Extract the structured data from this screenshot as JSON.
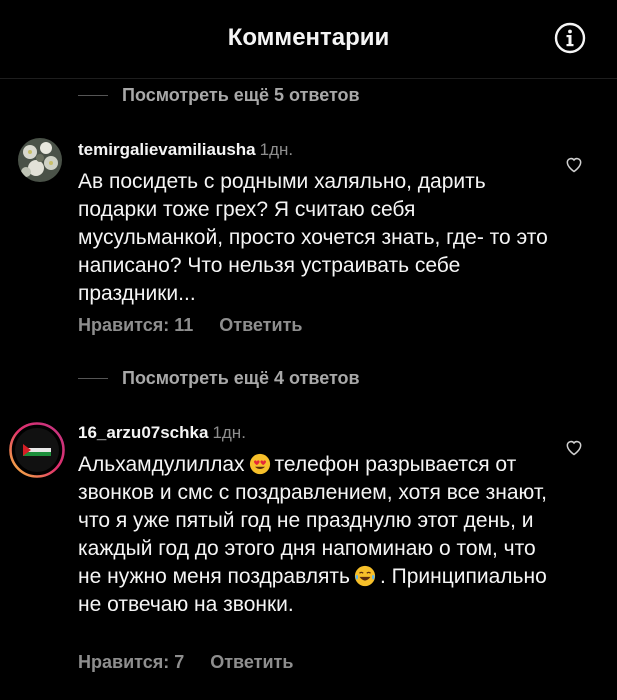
{
  "header": {
    "title": "Комментарии",
    "info_icon": "info-circle-icon"
  },
  "more_replies_1": "Посмотреть ещё 5 ответов",
  "comments": [
    {
      "username": "temirgalievamiliausha",
      "time": "1дн.",
      "text": "Ав посидеть с родными халяльно, дарить подарки  тоже грех? Я считаю себя мусульманкой, просто хочется знать, где- то это написано? Что нельзя устраивать себе праздники...",
      "likes": "Нравится: 11",
      "reply": "Ответить"
    },
    {
      "username": "16_arzu07schka",
      "time": "1дн.",
      "text_part1": "Альхамдулиллах",
      "text_part2": "телефон разрывается от звонков и смс с поздравлением, хотя все знают, что я уже пятый год не празднулю этот день, и каждый год до этого дня напоминаю о том, что не нужно меня поздравлять",
      "text_part3": ". Принципиально не отвечаю на звонки.",
      "likes": "Нравится: 7",
      "reply": "Ответить"
    }
  ],
  "more_replies_2": "Посмотреть ещё 4 ответов",
  "icons": {
    "like": "heart-outline-icon",
    "emoji_1": "heart-eyes-emoji",
    "emoji_2": "tears-of-joy-emoji"
  }
}
